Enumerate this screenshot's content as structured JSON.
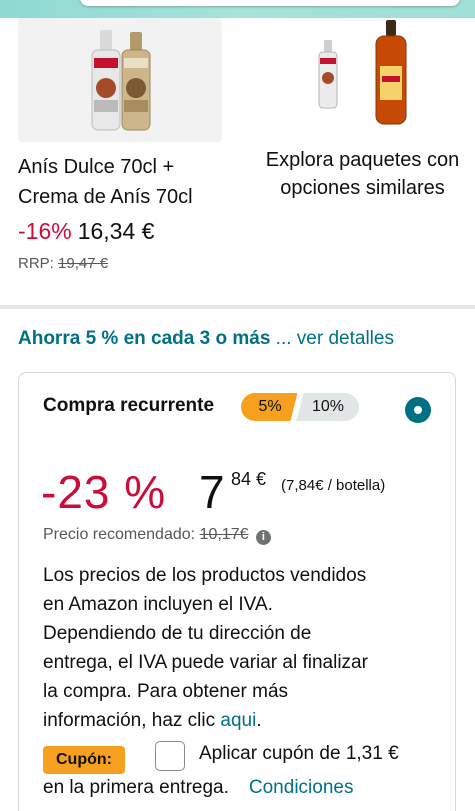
{
  "product": {
    "title_line1": "Anís Dulce 70cl +",
    "title_line2": "Crema de Anís 70cl",
    "discount": "-16%",
    "price": "16,34 €",
    "rrp_label": "RRP:",
    "rrp_value": "19,47 €"
  },
  "explore": {
    "line1": "Explora paquetes con",
    "line2": "opciones similares"
  },
  "savings": {
    "bold": "Ahorra 5 % en cada 3 o más",
    "link": "... ver detalles"
  },
  "subscription": {
    "title": "Compra recurrente",
    "tier1": "5%",
    "tier2": "10%",
    "discount": "-23 %",
    "price_whole": "7",
    "price_fraction": "84 €",
    "unit_price": "(7,84€ / botella)",
    "recommended_label": "Precio recomendado:",
    "recommended_value": "10,17€",
    "vat_line1": "Los precios de los productos vendidos",
    "vat_line2": "en Amazon incluyen el IVA.",
    "vat_line3": "Dependiendo de tu dirección de",
    "vat_line4": "entrega, el IVA puede variar al finalizar",
    "vat_line5": "la compra. Para obtener más",
    "vat_line6": "información, haz clic",
    "vat_link": "aqui",
    "vat_end": "."
  },
  "coupon": {
    "badge": "Cupón:",
    "text": "Aplicar cupón de 1,31 €",
    "line2": "en la primera entrega.",
    "conditions": "Condiciones"
  },
  "colors": {
    "accent_teal": "#007185",
    "discount_red": "#cc0c39",
    "badge_orange": "#f7a01f"
  }
}
